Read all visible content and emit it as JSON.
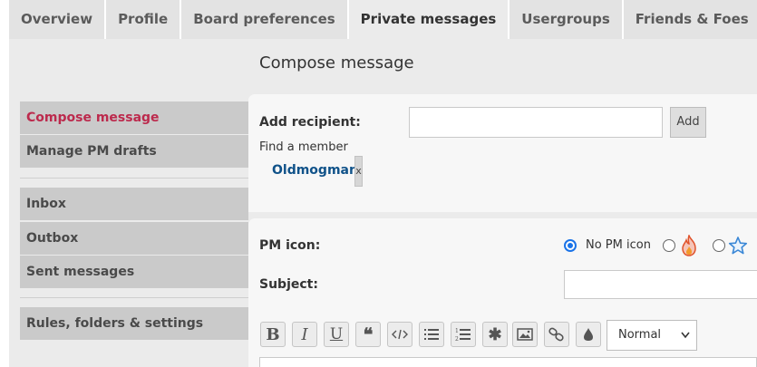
{
  "tabs": [
    "Overview",
    "Profile",
    "Board preferences",
    "Private messages",
    "Usergroups",
    "Friends & Foes"
  ],
  "active_tab": "Private messages",
  "page_title": "Compose message",
  "nav": {
    "compose": "Compose message",
    "drafts": "Manage PM drafts",
    "inbox": "Inbox",
    "outbox": "Outbox",
    "sent": "Sent messages",
    "rules": "Rules, folders & settings"
  },
  "recipient": {
    "label": "Add recipient:",
    "value": "",
    "add_button": "Add",
    "find_member": "Find a member",
    "member_name": "Oldmogman",
    "remove": "x"
  },
  "pm_icon": {
    "label": "PM icon:",
    "no_icon_label": "No PM icon",
    "selected": "No PM icon",
    "options": [
      "no-icon",
      "fire-icon",
      "star-icon"
    ]
  },
  "subject": {
    "label": "Subject:",
    "value": ""
  },
  "toolbar": {
    "bold": "B",
    "italic": "I",
    "underline": "U",
    "font_size": "Normal"
  },
  "colors": {
    "accent": "#bc2a4d",
    "link": "#105289",
    "radio": "#1a73e8"
  }
}
